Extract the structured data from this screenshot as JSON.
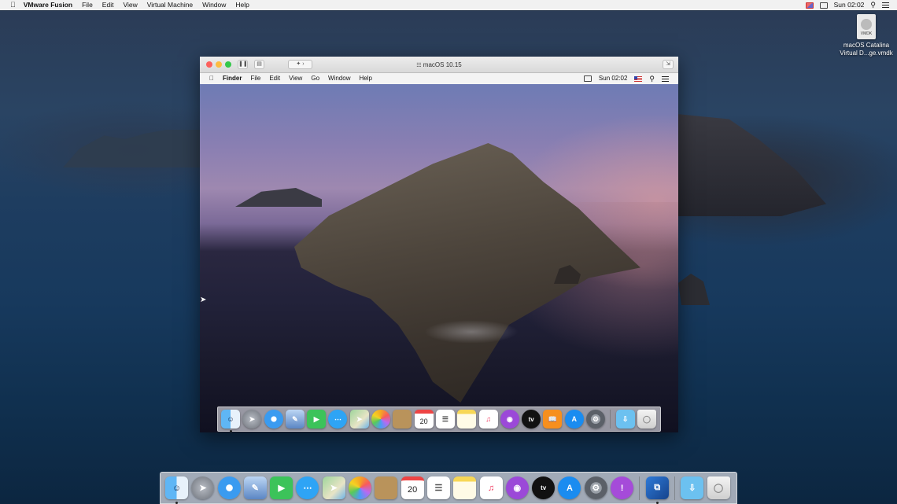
{
  "host_menubar": {
    "app_name": "VMware Fusion",
    "menus": [
      "File",
      "Edit",
      "View",
      "Virtual Machine",
      "Window",
      "Help"
    ],
    "clock": "Sun 02:02"
  },
  "desktop_file": {
    "icon_badge": "VMDK",
    "name_line1": "macOS Catalina",
    "name_line2": "Virtual D...ge.vmdk"
  },
  "vm_window": {
    "title": "macOS 10.15",
    "guest_menubar": {
      "app_name": "Finder",
      "menus": [
        "File",
        "Edit",
        "View",
        "Go",
        "Window",
        "Help"
      ],
      "clock": "Sun 02:02"
    }
  },
  "guest_dock": {
    "calendar_day": "20",
    "tv_label": "tv"
  },
  "host_dock": {
    "calendar_day": "20",
    "tv_label": "tv"
  }
}
